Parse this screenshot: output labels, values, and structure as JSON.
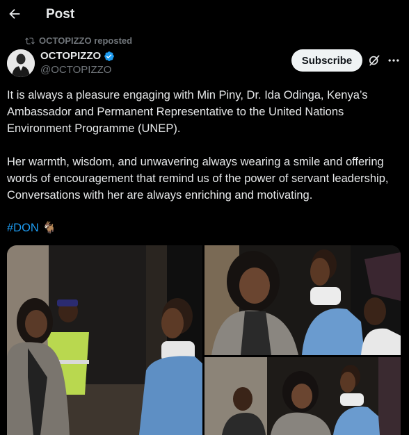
{
  "header": {
    "title": "Post"
  },
  "repost": {
    "text": "OCTOPIZZO reposted"
  },
  "author": {
    "name": "OCTOPIZZO",
    "handle": "@OCTOPIZZO",
    "verified": true
  },
  "actions": {
    "subscribe_label": "Subscribe"
  },
  "post": {
    "paragraph1": "It is always a pleasure engaging with Min Piny, Dr. Ida Odinga, Kenya’s Ambassador and Permanent Representative to the United Nations Environment Programme (UNEP).",
    "paragraph2": "Her warmth, wisdom, and unwavering always wearing a smile and offering words of encouragement that remind us of the power of servant leadership, Conversations with her are always enriching and motivating.",
    "hashtag": "#DON",
    "emoji": "🐐"
  },
  "colors": {
    "background": "#000000",
    "text": "#e7e9ea",
    "muted": "#71767b",
    "link": "#1d9bf0",
    "verified": "#1d9bf0"
  },
  "icons": {
    "back": "arrow-left-icon",
    "repost": "repost-icon",
    "verified": "verified-badge-icon",
    "grok": "grok-icon",
    "more": "more-icon"
  }
}
